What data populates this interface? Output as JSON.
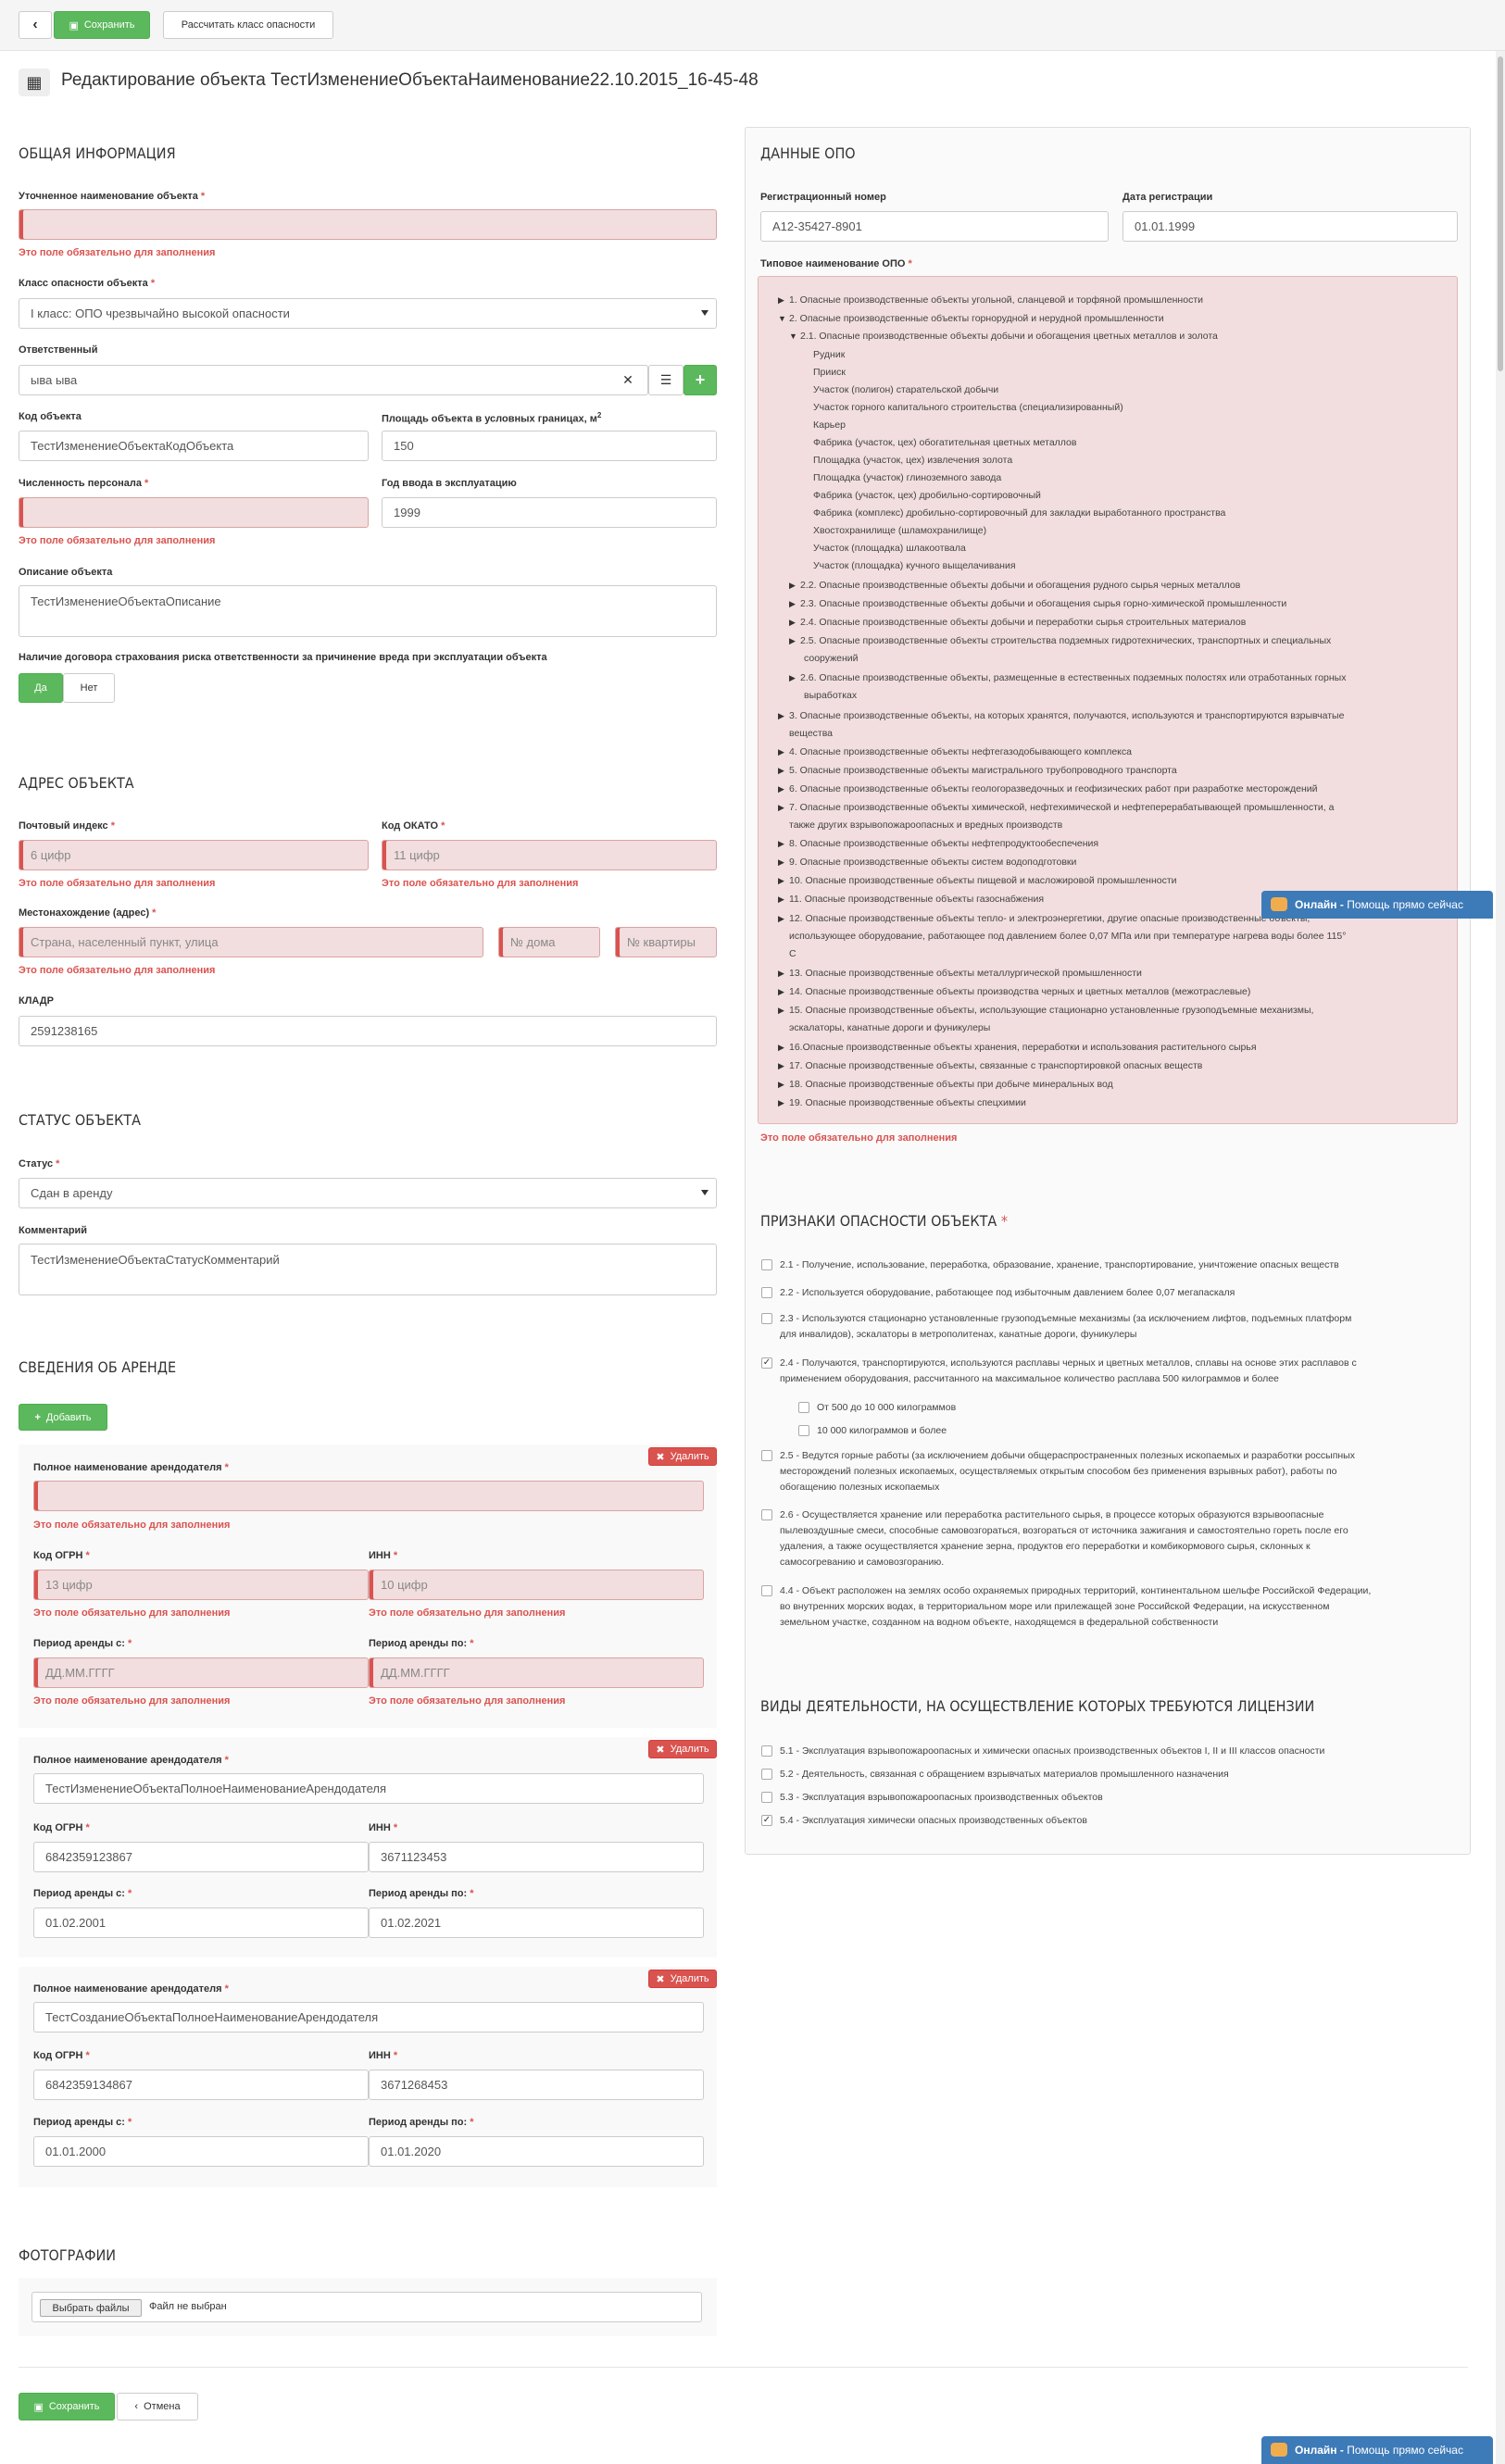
{
  "toolbar": {
    "save": "Сохранить",
    "calc": "Рассчитать класс опасности"
  },
  "page_title": "Редактирование объекта ТестИзменениеОбъектаНаименование22.10.2015_16-45-48",
  "required_error": "Это поле обязательно для заполнения",
  "general": {
    "header": "Общая информация",
    "name_label": "Уточненное наименование объекта",
    "hazard_class_label": "Класс опасности объекта",
    "hazard_class_value": "I класс: ОПО чрезвычайно высокой опасности",
    "responsible_label": "Ответственный",
    "responsible_value": "ыва ыва",
    "code_label": "Код объекта",
    "code_value": "ТестИзменениеОбъектаКодОбъекта",
    "area_label": "Площадь объекта в условных границах, м",
    "area_sup": "2",
    "area_value": "150",
    "staff_label": "Численность персонала",
    "year_label": "Год ввода в эксплуатацию",
    "year_value": "1999",
    "desc_label": "Описание объекта",
    "desc_value": "ТестИзменениеОбъектаОписание",
    "insurance_label": "Наличие договора страхования риска ответственности за причинение вреда при эксплуатации объекта",
    "yes": "Да",
    "no": "Нет"
  },
  "address": {
    "header": "Адрес объекта",
    "postal_label": "Почтовый индекс",
    "postal_placeholder": "6 цифр",
    "okato_label": "Код ОКАТО",
    "okato_placeholder": "11 цифр",
    "location_label": "Местонахождение (адрес)",
    "location_placeholder": "Страна, населенный пункт, улица",
    "house_placeholder": "№ дома",
    "flat_placeholder": "№ квартиры",
    "kladr_label": "КЛАДР",
    "kladr_value": "2591238165"
  },
  "status": {
    "header": "Статус объекта",
    "status_label": "Статус",
    "status_value": "Сдан в аренду",
    "comment_label": "Комментарий",
    "comment_value": "ТестИзменениеОбъектаСтатусКомментарий"
  },
  "lease": {
    "header": "Сведения об аренде",
    "add": "Добавить",
    "delete": "Удалить",
    "name_label": "Полное наименование арендодателя",
    "ogrn_label": "Код ОГРН",
    "inn_label": "ИНН",
    "from_label": "Период аренды с:",
    "to_label": "Период аренды по:",
    "ogrn_placeholder": "13 цифр",
    "inn_placeholder": "10 цифр",
    "date_placeholder": "ДД.ММ.ГГГГ",
    "l2": {
      "name": "ТестИзменениеОбъектаПолноеНаименованиеАрендодателя",
      "ogrn": "6842359123867",
      "inn": "3671123453",
      "from": "01.02.2001",
      "to": "01.02.2021"
    },
    "l3": {
      "name": "ТестСозданиеОбъектаПолноеНаименованиеАрендодателя",
      "ogrn": "6842359134867",
      "inn": "3671268453",
      "from": "01.01.2000",
      "to": "01.01.2020"
    }
  },
  "photos": {
    "header": "Фотографии",
    "choose": "Выбрать файлы",
    "none": "Файл не выбран"
  },
  "footer": {
    "save": "Сохранить",
    "cancel": "Отмена"
  },
  "opo": {
    "header": "Данные ОПО",
    "reg_label": "Регистрационный номер",
    "reg_value": "А12-35427-8901",
    "date_label": "Дата регистрации",
    "date_value": "01.01.1999",
    "type_label": "Типовое наименование ОПО",
    "tree": [
      "1. Опасные производственные объекты угольной, сланцевой и торфяной промышленности",
      "2. Опасные производственные объекты горнорудной и нерудной промышленности",
      "2.1. Опасные производственные объекты добычи и обогащения цветных металлов и золота",
      "Рудник",
      "Прииск",
      "Участок (полигон) старательской добычи",
      "Участок горного капитального строительства (специализированный)",
      "Карьер",
      "Фабрика (участок, цех) обогатительная цветных металлов",
      "Площадка (участок, цех) извлечения золота",
      "Площадка (участок) глиноземного завода",
      "Фабрика (участок, цех) дробильно-сортировочный",
      "Фабрика (комплекс) дробильно-сортировочный для закладки выработанного пространства",
      "Хвостохранилище (шламохранилище)",
      "Участок (площадка) шлакоотвала",
      "Участок (площадка) кучного выщелачивания",
      "2.2. Опасные производственные объекты добычи и обогащения рудного сырья черных металлов",
      "2.3. Опасные производственные объекты добычи и обогащения сырья горно-химической промышленности",
      "2.4. Опасные производственные объекты добычи и переработки сырья строительных материалов",
      "2.5. Опасные производственные объекты строительства подземных гидротехнических, транспортных и специальных",
      "сооружений",
      "2.6. Опасные производственные объекты, размещенные в естественных подземных полостях или отработанных горных",
      "выработках",
      "3. Опасные производственные объекты, на которых хранятся, получаются, используются и транспортируются взрывчатые",
      "вещества",
      "4. Опасные производственные объекты нефтегазодобывающего комплекса",
      "5. Опасные производственные объекты магистрального трубопроводного транспорта",
      "6. Опасные производственные объекты геологоразведочных и геофизических работ при разработке месторождений",
      "7. Опасные производственные объекты химической, нефтехимической и нефтеперерабатывающей промышленности, а",
      "также других взрывопожароопасных и вредных производств",
      "8. Опасные производственные объекты нефтепродуктообеспечения",
      "9. Опасные производственные объекты систем водоподготовки",
      "10. Опасные производственные объекты пищевой и масложировой промышленности",
      "11. Опасные производственные объекты газоснабжения",
      "12. Опасные производственные объекты тепло- и электроэнергетики, другие опасные производственные объекты,",
      "использующее оборудование, работающее под давлением более 0,07 МПа или при температуре нагрева воды более 115°",
      "С",
      "13. Опасные производственные объекты металлургической промышленности",
      "14. Опасные производственные объекты производства черных и цветных металлов (межотраслевые)",
      "15. Опасные производственные объекты, использующие стационарно установленные грузоподъемные механизмы,",
      "эскалаторы, канатные дороги и фуникулеры",
      "16.Опасные производственные объекты хранения, переработки и использования растительного сырья",
      "17. Опасные производственные объекты, связанные с транспортировкой опасных веществ",
      "18. Опасные производственные объекты при добыче минеральных вод",
      "19. Опасные производственные объекты спецхимии"
    ]
  },
  "signs": {
    "header": "Признаки опасности объекта",
    "items": [
      [
        "2.1 - Получение, использование, переработка, образование, хранение, транспортирование, уничтожение опасных веществ"
      ],
      [
        "2.2 - Используется оборудование, работающее под избыточным давлением более 0,07 мегапаскаля"
      ],
      [
        "2.3 - Используются стационарно установленные грузоподъемные механизмы (за исключением лифтов, подъемных платформ",
        "для инвалидов), эскалаторы в метрополитенах, канатные дороги, фуникулеры"
      ],
      [
        "2.4 - Получаются, транспортируются, используются расплавы черных и цветных металлов, сплавы на основе этих расплавов с",
        "применением оборудования, рассчитанного на максимальное количество расплава 500 килограммов и более"
      ],
      [
        "От 500 до 10 000 килограммов"
      ],
      [
        "10 000 килограммов и более"
      ],
      [
        "2.5 - Ведутся горные работы (за исключением добычи общераспространенных полезных ископаемых и разработки россыпных",
        "месторождений полезных ископаемых, осуществляемых открытым способом без применения взрывных работ), работы по",
        "обогащению полезных ископаемых"
      ],
      [
        "2.6 - Осуществляется хранение или переработка растительного сырья, в процессе которых образуются взрывоопасные",
        "пылевоздушные смеси, способные самовозгораться, возгораться от источника зажигания и самостоятельно гореть после его",
        "удаления, а также осуществляется хранение зерна, продуктов его переработки и комбикормового сырья, склонных к",
        "самосогреванию и самовозгоранию."
      ],
      [
        "4.4 - Объект расположен на землях особо охраняемых природных территорий, континентальном шельфе Российской Федерации,",
        "во внутренних морских водах, в территориальном море или прилежащей зоне Российской Федерации, на искусственном",
        "земельном участке, созданном на водном объекте, находящемся в федеральной собственности"
      ]
    ],
    "checked": [
      false,
      false,
      false,
      true,
      false,
      false,
      false,
      false,
      false
    ]
  },
  "licenses": {
    "header": "Виды деятельности, на осуществление которых требуются лицензии",
    "items": [
      "5.1 - Эксплуатация взрывопожароопасных и химически опасных производственных объектов I, II и III классов опасности",
      "5.2 - Деятельность, связанная с обращением взрывчатых материалов промышленного назначения",
      "5.3 - Эксплуатация взрывопожароопасных производственных объектов",
      "5.4 - Эксплуатация химически опасных производственных объектов"
    ],
    "checked": [
      false,
      false,
      false,
      true
    ]
  },
  "chat": {
    "online": "Онлайн -",
    "help": "Помощь прямо сейчас"
  },
  "icons": [
    "back-arrow-icon",
    "floppy-icon",
    "cube-icon",
    "clear-icon",
    "list-icon",
    "plus-icon",
    "times-icon",
    "chat-icon"
  ]
}
